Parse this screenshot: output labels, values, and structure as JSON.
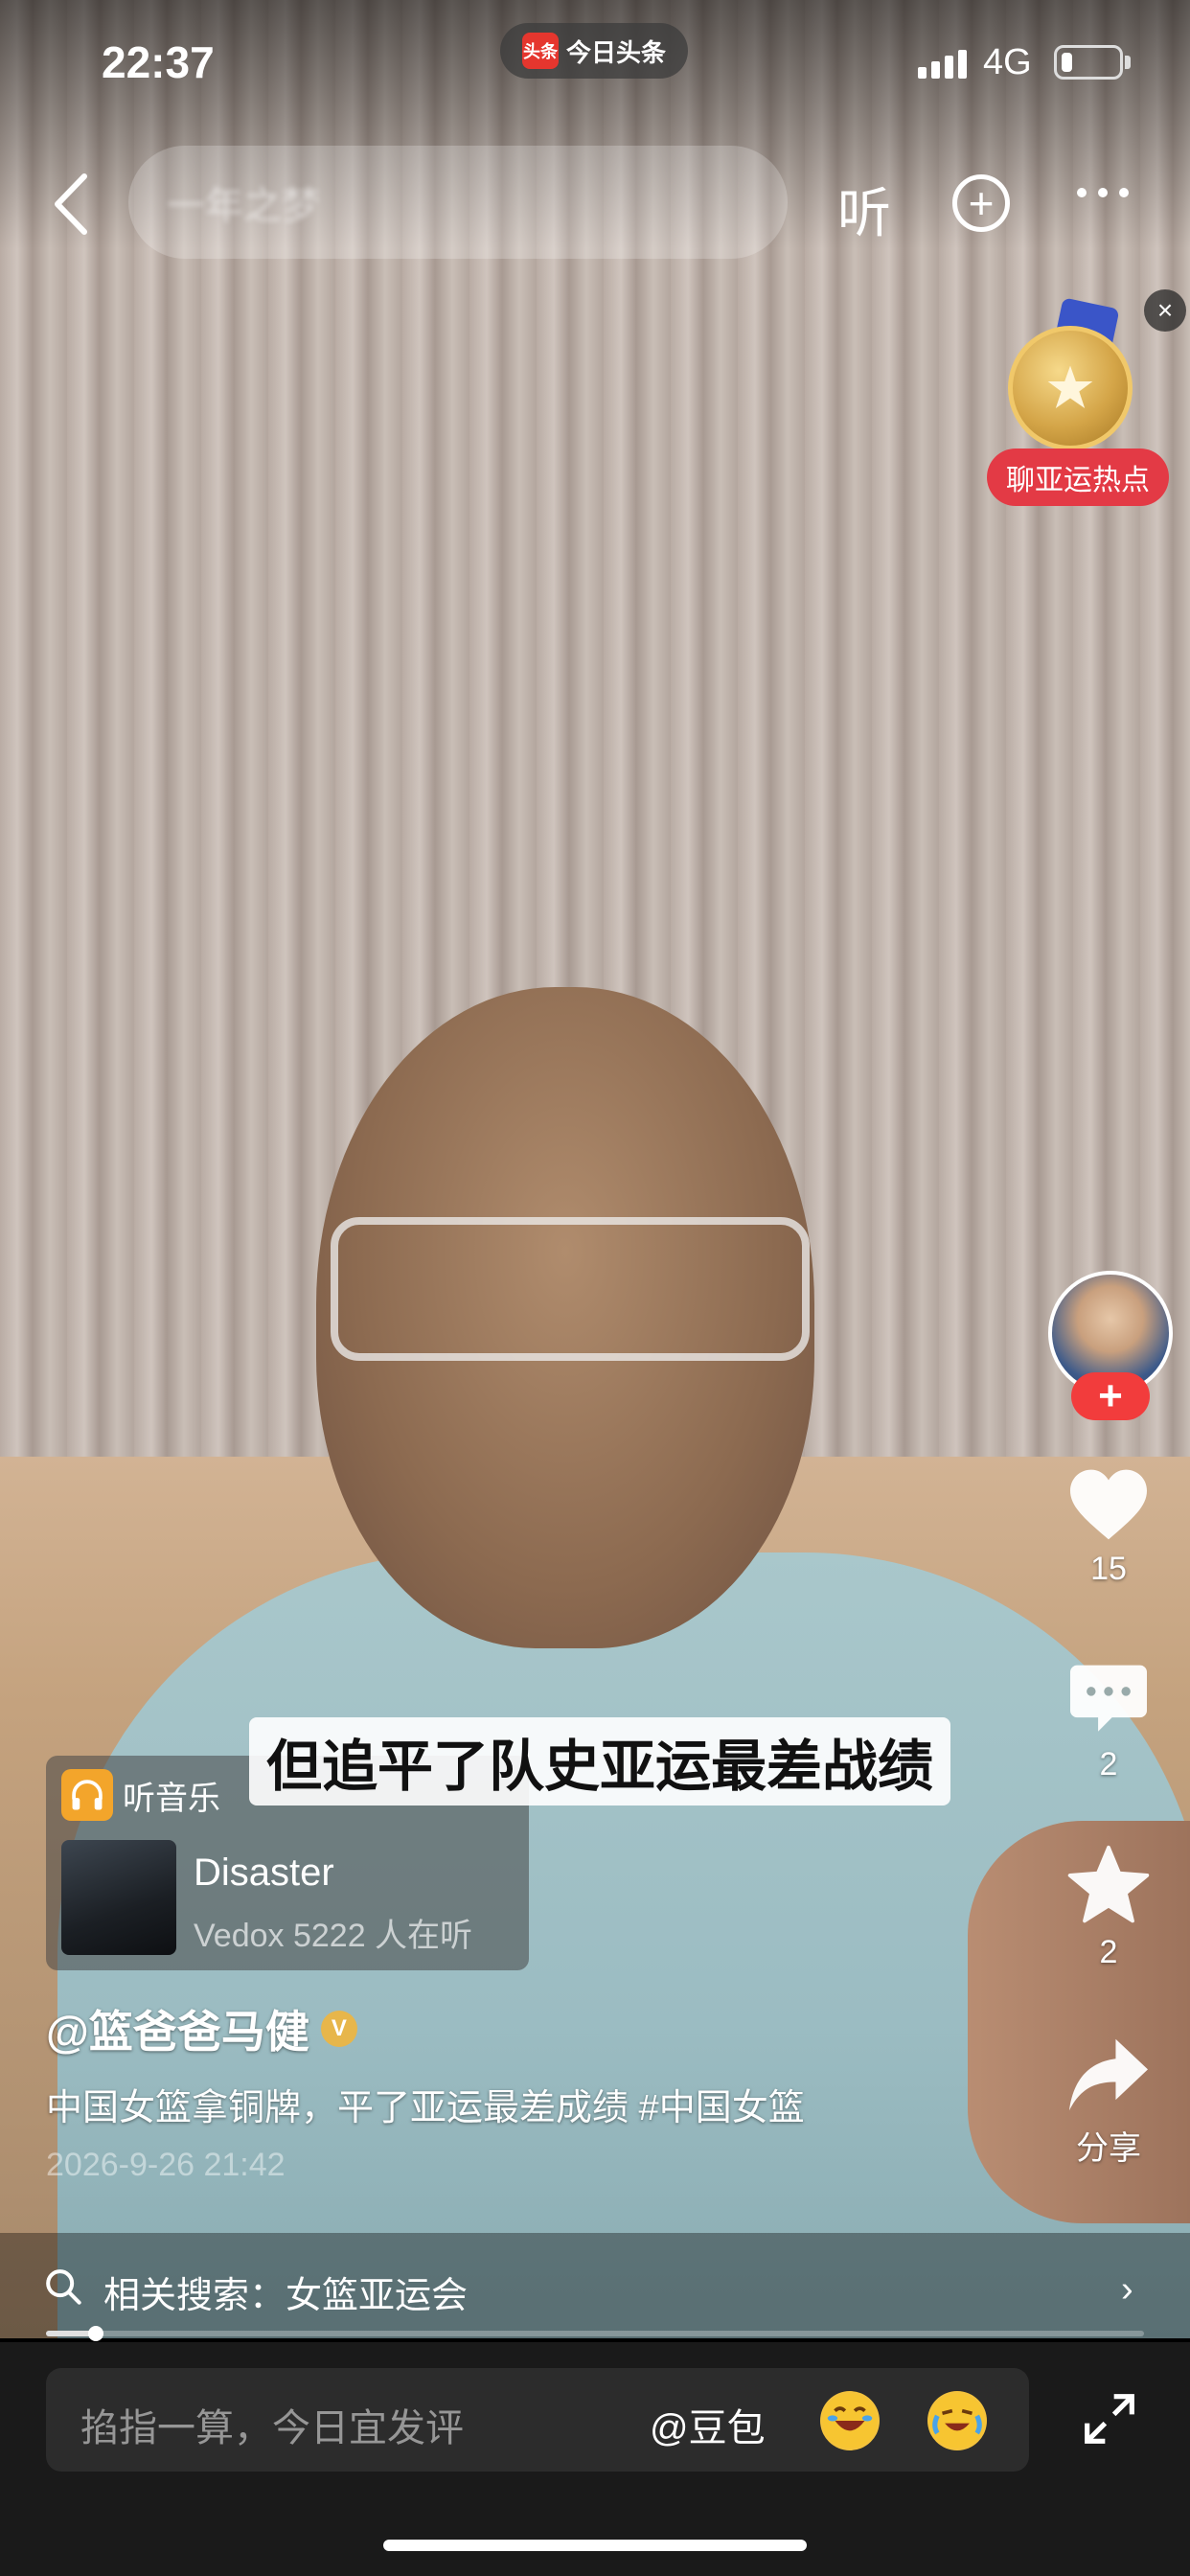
{
  "status_bar": {
    "time": "22:37",
    "app_name": "今日头条",
    "app_logo_text": "头条",
    "network": "4G",
    "battery_level": 0.2
  },
  "top_nav": {
    "search_text": "一年之梦",
    "listen_label": "听",
    "plus_symbol": "+"
  },
  "promo": {
    "close_symbol": "×",
    "label": "聊亚运热点"
  },
  "actions": {
    "follow_symbol": "+",
    "like_count": "15",
    "comment_count": "2",
    "favorite_count": "2",
    "share_label": "分享"
  },
  "subtitle": "但追平了队史亚运最差战绩",
  "music": {
    "header": "听音乐",
    "title": "Disaster",
    "subtitle": "Vedox 5222 人在听"
  },
  "post": {
    "author": "@篮爸爸马健",
    "verified_mark": "V",
    "description": "中国女篮拿铜牌，平了亚运最差成绩 #中国女篮",
    "date": "2026-9-26 21:42"
  },
  "related_search": {
    "text": "相关搜索：女篮亚运会",
    "chevron": "›"
  },
  "progress": 0.045,
  "comment": {
    "placeholder": "掐指一算，今日宜发评",
    "mention": "@豆包"
  },
  "colors": {
    "accent_red": "#f23c3c",
    "promo_red": "#e33a45",
    "music_orange": "#f3a52b",
    "verified_gold": "#e7b64b"
  }
}
